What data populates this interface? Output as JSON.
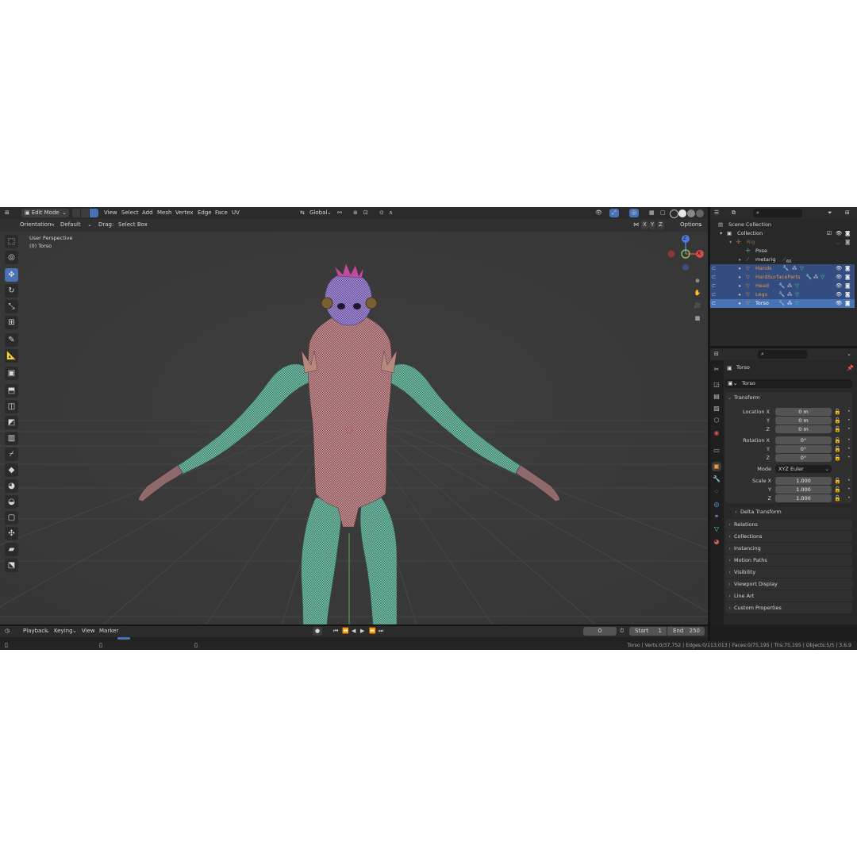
{
  "topbar": {
    "mode": "Edit Mode",
    "menus": [
      "View",
      "Select",
      "Add",
      "Mesh",
      "Vertex",
      "Edge",
      "Face",
      "UV"
    ],
    "transform_orientation": "Global"
  },
  "viewport": {
    "orientation_label": "Orientation:",
    "orientation_value": "Default",
    "drag_label": "Drag:",
    "drag_value": "Select Box",
    "mirror_axes": [
      "X",
      "Y",
      "Z"
    ],
    "options_label": "Options",
    "overlay_title": "User Perspective",
    "overlay_object": "(0) Torso",
    "gizmo": {
      "z": "Z",
      "x": "X"
    }
  },
  "outliner": {
    "scene_collection": "Scene Collection",
    "collection": "Collection",
    "rig": "Rig",
    "pose": "Pose",
    "metarig": "metarig",
    "metarig_badge": "60",
    "objects": [
      "Hands",
      "HardSurfaceParts",
      "Head",
      "Legs",
      "Torso"
    ]
  },
  "properties": {
    "object_name": "Torso",
    "object_field": "Torso",
    "transform_title": "Transform",
    "location_label": "Location X",
    "location_values": [
      "0 m",
      "0 m",
      "0 m"
    ],
    "rotation_label": "Rotation X",
    "rotation_values": [
      "0°",
      "0°",
      "0°"
    ],
    "axis_y": "Y",
    "axis_z": "Z",
    "mode_label": "Mode",
    "mode_value": "XYZ Euler",
    "scale_label": "Scale X",
    "scale_values": [
      "1.000",
      "1.000",
      "1.000"
    ],
    "delta_transform": "Delta Transform",
    "panels": [
      "Relations",
      "Collections",
      "Instancing",
      "Motion Paths",
      "Visibility",
      "Viewport Display",
      "Line Art",
      "Custom Properties"
    ]
  },
  "timeline": {
    "menus": [
      "Playback",
      "Keying",
      "View",
      "Marker"
    ],
    "current_frame": "0",
    "start_label": "Start",
    "start_value": "1",
    "end_label": "End",
    "end_value": "250"
  },
  "statusbar": {
    "text": "Torso | Verts:0/37,752 | Edges:0/113,013 | Faces:0/75,195 | Tris:75,195 | Objects:5/5 | 3.6.9"
  },
  "colors": {
    "accent": "#4772b3",
    "selection_row": "#334d80",
    "viewport_bg": "#3a3a3a",
    "panel_bg": "#303030",
    "object_orange": "#e8943a",
    "mesh_green": "#6ab5a0",
    "mesh_pink": "#c78a8f",
    "mesh_purple": "#9a7fd0"
  }
}
